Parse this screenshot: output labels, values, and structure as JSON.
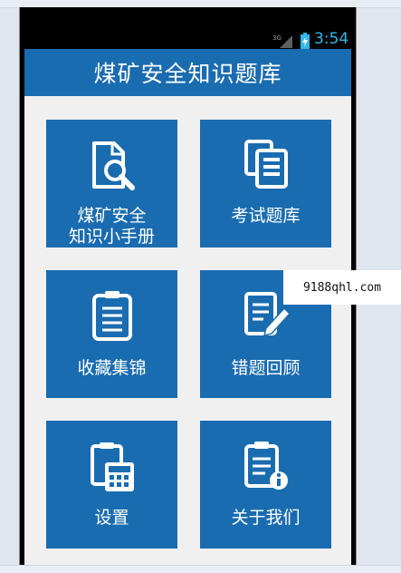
{
  "status_bar": {
    "network": "3G",
    "time": "3:54",
    "colors": {
      "time": "#31b6e7"
    }
  },
  "app": {
    "title": "煤矿安全知识题库",
    "colors": {
      "primary": "#1a6cb0",
      "background": "#f0f0f0"
    }
  },
  "tiles": [
    {
      "label": "煤矿安全\n知识小手册",
      "icon": "document-search-icon"
    },
    {
      "label": "考试题库",
      "icon": "documents-list-icon"
    },
    {
      "label": "收藏集锦",
      "icon": "clipboard-icon"
    },
    {
      "label": "错题回顾",
      "icon": "document-edit-icon"
    },
    {
      "label": "设置",
      "icon": "calculator-icon"
    },
    {
      "label": "关于我们",
      "icon": "clipboard-info-icon"
    }
  ],
  "watermark": {
    "text": "9188qhl.com"
  }
}
